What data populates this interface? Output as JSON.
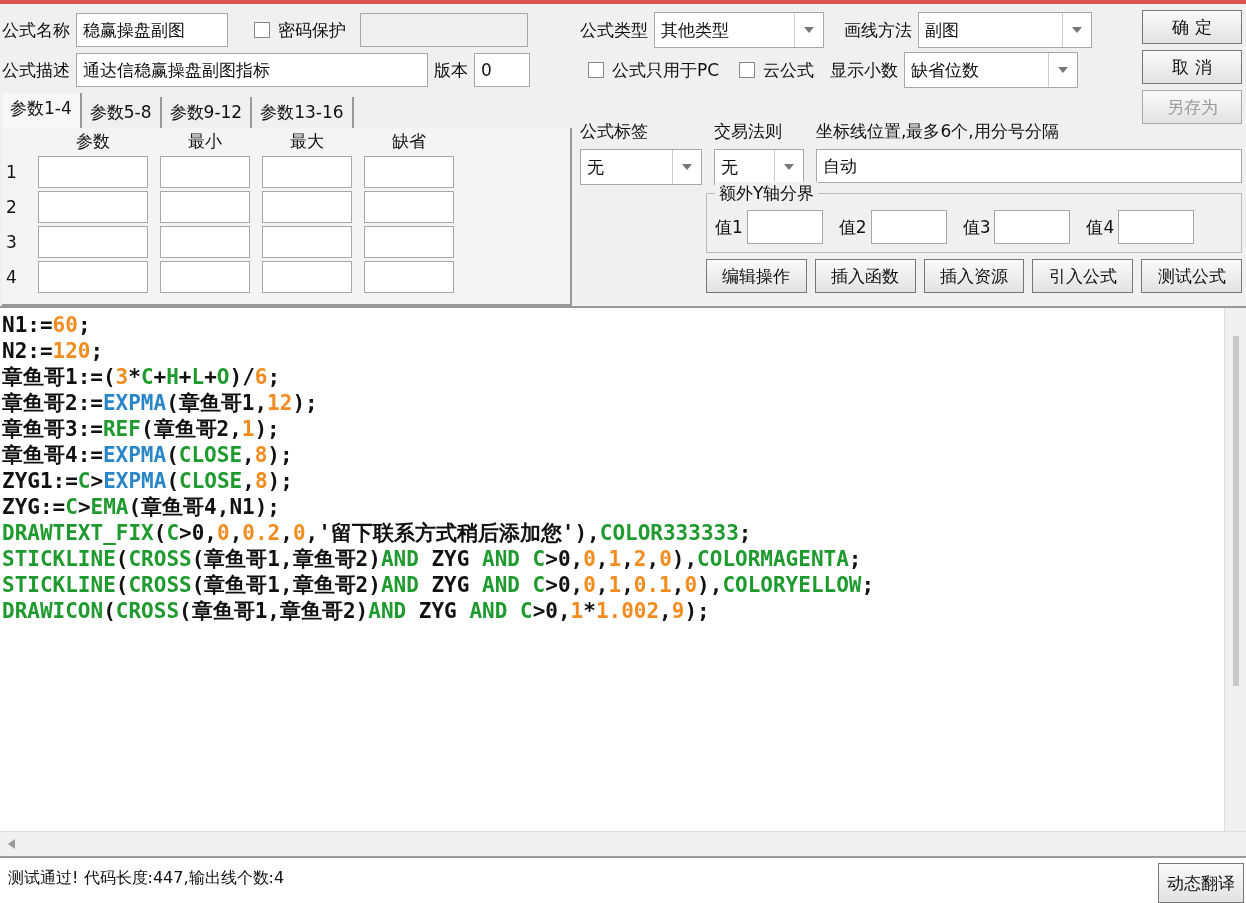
{
  "formula_name": {
    "label": "公式名称",
    "value": "稳赢操盘副图"
  },
  "password_protect": {
    "label": "密码保护",
    "checked": false
  },
  "description": {
    "label": "公式描述",
    "value": "通达信稳赢操盘副图指标"
  },
  "version": {
    "label": "版本",
    "value": "0"
  },
  "param_tabs": [
    {
      "label": "参数1-4",
      "selected": true
    },
    {
      "label": "参数5-8",
      "selected": false
    },
    {
      "label": "参数9-12",
      "selected": false
    },
    {
      "label": "参数13-16",
      "selected": false
    }
  ],
  "param_table": {
    "columns": [
      "参数",
      "最小",
      "最大",
      "缺省"
    ],
    "rows": [
      "1",
      "2",
      "3",
      "4"
    ]
  },
  "formula_type": {
    "label": "公式类型",
    "value": "其他类型"
  },
  "draw_method": {
    "label": "画线方法",
    "value": "副图"
  },
  "pc_only": {
    "label": "公式只用于PC",
    "checked": false
  },
  "cloud_formula": {
    "label": "云公式",
    "checked": false
  },
  "decimals": {
    "label": "显示小数",
    "value": "缺省位数"
  },
  "action_buttons": [
    {
      "label": "确 定",
      "disabled": false
    },
    {
      "label": "取 消",
      "disabled": false
    },
    {
      "label": "另存为",
      "disabled": true
    }
  ],
  "formula_tag": {
    "label": "公式标签",
    "value": "无"
  },
  "trade_rule": {
    "label": "交易法则",
    "value": "无"
  },
  "axis_lines": {
    "label": "坐标线位置,最多6个,用分号分隔",
    "value": "自动"
  },
  "extra_y_axis": {
    "title": "额外Y轴分界",
    "fields": [
      "值1",
      "值2",
      "值3",
      "值4"
    ]
  },
  "tool_buttons": [
    "编辑操作",
    "插入函数",
    "插入资源",
    "引入公式",
    "测试公式"
  ],
  "code_lines": [
    [
      {
        "kind": "text",
        "text": "N1:="
      },
      {
        "kind": "number",
        "text": "60"
      },
      {
        "kind": "text",
        "text": ";"
      }
    ],
    [
      {
        "kind": "text",
        "text": "N2:="
      },
      {
        "kind": "number",
        "text": "120"
      },
      {
        "kind": "text",
        "text": ";"
      }
    ],
    [
      {
        "kind": "text",
        "text": "章鱼哥1:=("
      },
      {
        "kind": "number",
        "text": "3"
      },
      {
        "kind": "text",
        "text": "*"
      },
      {
        "kind": "keyword",
        "text": "C"
      },
      {
        "kind": "text",
        "text": "+"
      },
      {
        "kind": "keyword",
        "text": "H"
      },
      {
        "kind": "text",
        "text": "+"
      },
      {
        "kind": "keyword",
        "text": "L"
      },
      {
        "kind": "text",
        "text": "+"
      },
      {
        "kind": "keyword",
        "text": "O"
      },
      {
        "kind": "text",
        "text": ")/"
      },
      {
        "kind": "number",
        "text": "6"
      },
      {
        "kind": "text",
        "text": ";"
      }
    ],
    [
      {
        "kind": "text",
        "text": "章鱼哥2:="
      },
      {
        "kind": "function",
        "text": "EXPMA"
      },
      {
        "kind": "text",
        "text": "(章鱼哥1,"
      },
      {
        "kind": "number",
        "text": "12"
      },
      {
        "kind": "text",
        "text": ");"
      }
    ],
    [
      {
        "kind": "text",
        "text": "章鱼哥3:="
      },
      {
        "kind": "keyword",
        "text": "REF"
      },
      {
        "kind": "text",
        "text": "(章鱼哥2,"
      },
      {
        "kind": "number",
        "text": "1"
      },
      {
        "kind": "text",
        "text": ");"
      }
    ],
    [
      {
        "kind": "text",
        "text": "章鱼哥4:="
      },
      {
        "kind": "function",
        "text": "EXPMA"
      },
      {
        "kind": "text",
        "text": "("
      },
      {
        "kind": "keyword",
        "text": "CLOSE"
      },
      {
        "kind": "text",
        "text": ","
      },
      {
        "kind": "number",
        "text": "8"
      },
      {
        "kind": "text",
        "text": ");"
      }
    ],
    [
      {
        "kind": "text",
        "text": "ZYG1:="
      },
      {
        "kind": "keyword",
        "text": "C"
      },
      {
        "kind": "text",
        "text": ">"
      },
      {
        "kind": "function",
        "text": "EXPMA"
      },
      {
        "kind": "text",
        "text": "("
      },
      {
        "kind": "keyword",
        "text": "CLOSE"
      },
      {
        "kind": "text",
        "text": ","
      },
      {
        "kind": "number",
        "text": "8"
      },
      {
        "kind": "text",
        "text": ");"
      }
    ],
    [
      {
        "kind": "text",
        "text": "ZYG:="
      },
      {
        "kind": "keyword",
        "text": "C"
      },
      {
        "kind": "text",
        "text": ">"
      },
      {
        "kind": "keyword",
        "text": "EMA"
      },
      {
        "kind": "text",
        "text": "(章鱼哥4,N1);"
      }
    ],
    [
      {
        "kind": "keyword",
        "text": "DRAWTEXT_FIX"
      },
      {
        "kind": "text",
        "text": "("
      },
      {
        "kind": "keyword",
        "text": "C"
      },
      {
        "kind": "text",
        "text": ">0,"
      },
      {
        "kind": "number",
        "text": "0"
      },
      {
        "kind": "text",
        "text": ","
      },
      {
        "kind": "number",
        "text": "0.2"
      },
      {
        "kind": "text",
        "text": ","
      },
      {
        "kind": "number",
        "text": "0"
      },
      {
        "kind": "text",
        "text": ",'留下联系方式稍后添加您'),"
      },
      {
        "kind": "keyword",
        "text": "COLOR333333"
      },
      {
        "kind": "text",
        "text": ";"
      }
    ],
    [
      {
        "kind": "keyword",
        "text": "STICKLINE"
      },
      {
        "kind": "text",
        "text": "("
      },
      {
        "kind": "keyword",
        "text": "CROSS"
      },
      {
        "kind": "text",
        "text": "(章鱼哥1,章鱼哥2)"
      },
      {
        "kind": "keyword",
        "text": "AND"
      },
      {
        "kind": "text",
        "text": " ZYG "
      },
      {
        "kind": "keyword",
        "text": "AND C"
      },
      {
        "kind": "text",
        "text": ">0,"
      },
      {
        "kind": "number",
        "text": "0"
      },
      {
        "kind": "text",
        "text": ","
      },
      {
        "kind": "number",
        "text": "1"
      },
      {
        "kind": "text",
        "text": ","
      },
      {
        "kind": "number",
        "text": "2"
      },
      {
        "kind": "text",
        "text": ","
      },
      {
        "kind": "number",
        "text": "0"
      },
      {
        "kind": "text",
        "text": "),"
      },
      {
        "kind": "keyword",
        "text": "COLORMAGENTA"
      },
      {
        "kind": "text",
        "text": ";"
      }
    ],
    [
      {
        "kind": "keyword",
        "text": "STICKLINE"
      },
      {
        "kind": "text",
        "text": "("
      },
      {
        "kind": "keyword",
        "text": "CROSS"
      },
      {
        "kind": "text",
        "text": "(章鱼哥1,章鱼哥2)"
      },
      {
        "kind": "keyword",
        "text": "AND"
      },
      {
        "kind": "text",
        "text": " ZYG "
      },
      {
        "kind": "keyword",
        "text": "AND C"
      },
      {
        "kind": "text",
        "text": ">0,"
      },
      {
        "kind": "number",
        "text": "0"
      },
      {
        "kind": "text",
        "text": ","
      },
      {
        "kind": "number",
        "text": "1"
      },
      {
        "kind": "text",
        "text": ","
      },
      {
        "kind": "number",
        "text": "0.1"
      },
      {
        "kind": "text",
        "text": ","
      },
      {
        "kind": "number",
        "text": "0"
      },
      {
        "kind": "text",
        "text": "),"
      },
      {
        "kind": "keyword",
        "text": "COLORYELLOW"
      },
      {
        "kind": "text",
        "text": ";"
      }
    ],
    [
      {
        "kind": "keyword",
        "text": "DRAWICON"
      },
      {
        "kind": "text",
        "text": "("
      },
      {
        "kind": "keyword",
        "text": "CROSS"
      },
      {
        "kind": "text",
        "text": "(章鱼哥1,章鱼哥2)"
      },
      {
        "kind": "keyword",
        "text": "AND"
      },
      {
        "kind": "text",
        "text": " ZYG "
      },
      {
        "kind": "keyword",
        "text": "AND C"
      },
      {
        "kind": "text",
        "text": ">0,"
      },
      {
        "kind": "number",
        "text": "1"
      },
      {
        "kind": "text",
        "text": "*"
      },
      {
        "kind": "number",
        "text": "1.002"
      },
      {
        "kind": "text",
        "text": ","
      },
      {
        "kind": "number",
        "text": "9"
      },
      {
        "kind": "text",
        "text": ");"
      }
    ]
  ],
  "status": {
    "message": "测试通过! 代码长度:447,输出线个数:4"
  },
  "translate_button": "动态翻译"
}
